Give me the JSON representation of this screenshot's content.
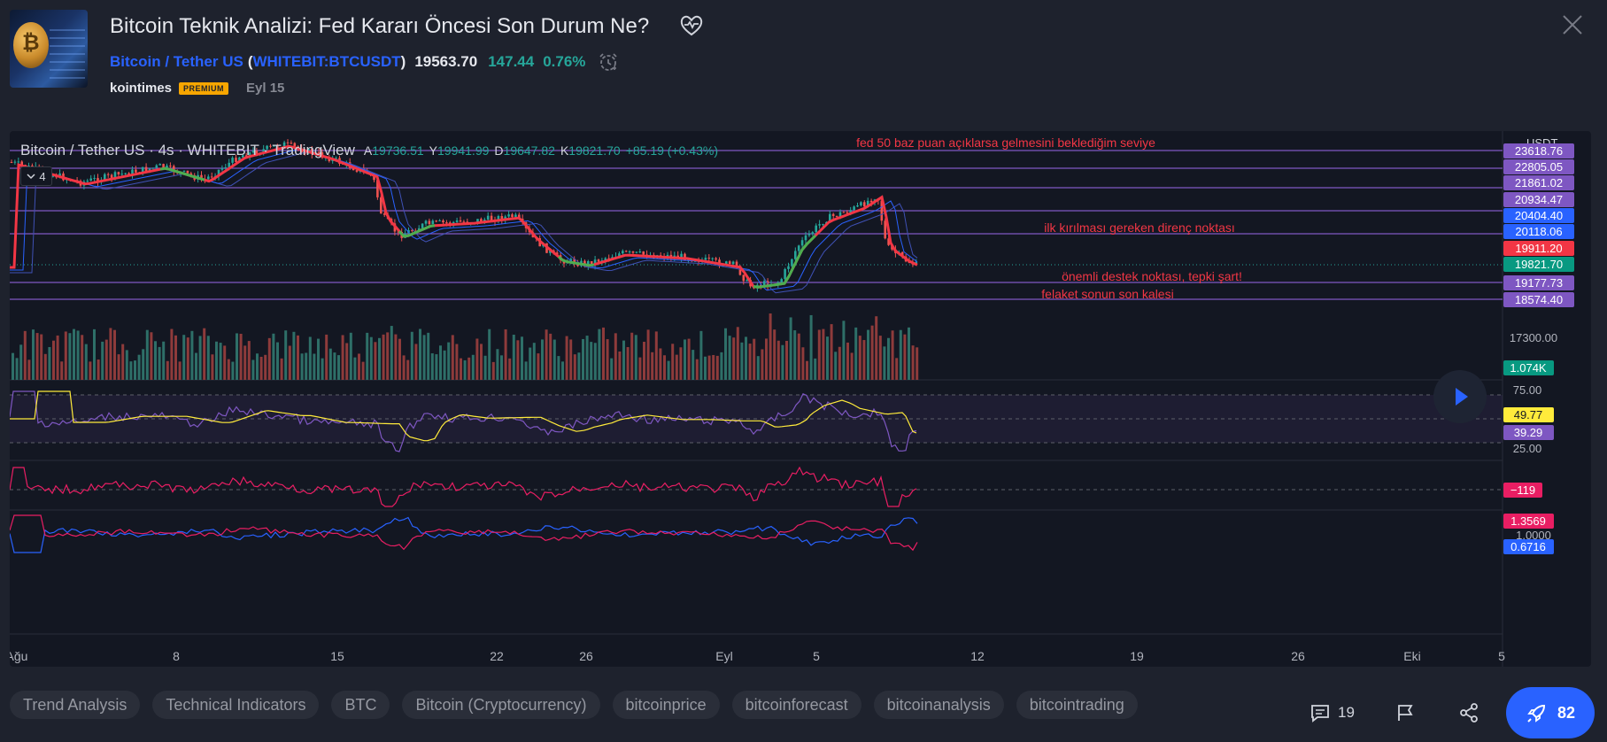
{
  "header": {
    "title": "Bitcoin Teknik Analizi: Fed Kararı Öncesi Son Durum Ne?",
    "symbol_name": "Bitcoin / Tether US",
    "symbol_code": "WHITEBIT:BTCUSDT",
    "paren_open": "(",
    "paren_close": ")",
    "price": "19563.70",
    "change": "147.44",
    "change_pct": "0.76%",
    "author": "kointimes",
    "badge": "PREMIUM",
    "date": "Eyl 15"
  },
  "chart": {
    "legend_title": "Bitcoin / Tether US · 4s · WHITEBIT · TradingView",
    "ohlc": [
      {
        "k": "A",
        "v": "19736.51"
      },
      {
        "k": "Y",
        "v": "19941.99"
      },
      {
        "k": "D",
        "v": "19647.82"
      },
      {
        "k": "K",
        "v": "19821.70"
      },
      {
        "k": "",
        "v": "+85.19 (+0.43%)"
      }
    ],
    "collapse_count": "4",
    "currency": "USDT",
    "colors": {
      "up": "#26a69a",
      "down": "#ef5350",
      "hline": "#7e57c2",
      "annotation": "#f23645",
      "ma_red": "#f23645",
      "ma_green": "#4caf50",
      "ma_blue": "#2962ff",
      "rsi": "#7e57c2",
      "rsi_ma": "#ffeb3b",
      "cci": "#e91e63"
    },
    "annotations": [
      "fed 50 baz puan açıklarsa gelmesini beklediğim seviye",
      "ilk kırılması gereken direnç noktası",
      "önemli destek noktası, tepki şart!",
      "felaket sonun son kalesi"
    ],
    "levels": [
      {
        "label": "23618.76",
        "color": "#7e57c2"
      },
      {
        "label": "22805.05",
        "color": "#7e57c2"
      },
      {
        "label": "21861.02",
        "color": "#7e57c2"
      },
      {
        "label": "20934.47",
        "color": "#7e57c2"
      },
      {
        "label": "20404.40",
        "color": "#2962ff"
      },
      {
        "label": "20118.06",
        "color": "#2962ff"
      },
      {
        "label": "19911.20",
        "color": "#f23645"
      },
      {
        "label": "19821.70",
        "color": "#089981"
      },
      {
        "label": "19177.73",
        "color": "#7e57c2"
      },
      {
        "label": "18574.40",
        "color": "#7e57c2"
      }
    ],
    "price_tick": "17300.00",
    "volume_label": "1.074K",
    "rsi_ticks": [
      "75.00",
      "25.00"
    ],
    "rsi_ma_value": "49.77",
    "rsi_value": "39.29",
    "cci_value": "−119",
    "dmi_plus": "1.3569",
    "dmi_ref": "1.0000",
    "dmi_minus": "0.6716",
    "x_ticks": [
      "Ağu",
      "8",
      "15",
      "22",
      "26",
      "Eyl",
      "5",
      "12",
      "19",
      "26",
      "Eki",
      "5"
    ]
  },
  "tags": [
    "Trend Analysis",
    "Technical Indicators",
    "BTC",
    "Bitcoin (Cryptocurrency)",
    "bitcoinprice",
    "bitcoinforecast",
    "bitcoinanalysis",
    "bitcointrading"
  ],
  "actions": {
    "comments": "19",
    "boosts": "82"
  }
}
